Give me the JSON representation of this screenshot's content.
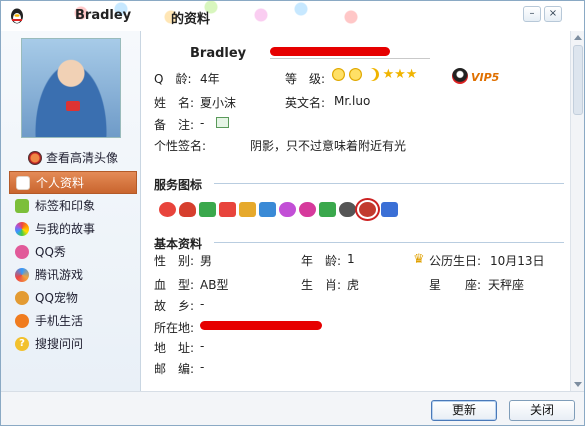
{
  "window": {
    "user_name": "Bradley",
    "title_suffix": "的资料",
    "minimize_glyph": "–",
    "close_glyph": "×"
  },
  "sidebar": {
    "hd_avatar_link": "查看高清头像",
    "items": [
      {
        "label": "个人资料",
        "active": true,
        "icon": "profile-card-icon",
        "color": "#ffffff"
      },
      {
        "label": "标签和印象",
        "active": false,
        "icon": "tag-icon",
        "color": "#7cbf3a"
      },
      {
        "label": "与我的故事",
        "active": false,
        "icon": "rainbow-icon",
        "color": "#c46bd6"
      },
      {
        "label": "QQ秀",
        "active": false,
        "icon": "qq-show-icon",
        "color": "#e15a9a"
      },
      {
        "label": "腾讯游戏",
        "active": false,
        "icon": "game-icon",
        "color": "#f2a23b"
      },
      {
        "label": "QQ宠物",
        "active": false,
        "icon": "pet-icon",
        "color": "#e39b33"
      },
      {
        "label": "手机生活",
        "active": false,
        "icon": "mobile-check-icon",
        "color": "#f07c1f"
      },
      {
        "label": "搜搜问问",
        "active": false,
        "icon": "question-icon",
        "color": "#f2c12e"
      }
    ]
  },
  "profile": {
    "nickname": "Bradley",
    "q_age_label": "Q　龄:",
    "q_age_value": "4年",
    "level_label": "等　级:",
    "vip_label": "VIP5",
    "name_label": "姓　名:",
    "name_value": "夏小沫",
    "english_name_label": "英文名:",
    "english_name_value": "Mr.luo",
    "note_label": "备　注:",
    "note_value": "-",
    "signature_label": "个性签名:",
    "signature_value": "阴影，只不过意味着附近有光"
  },
  "services": {
    "title": "服务图标",
    "icon_colors": [
      "#e8443c",
      "#d63f2e",
      "#3aa84c",
      "#e8443c",
      "#e6a92c",
      "#3a8ad6",
      "#c24fd6",
      "#d63a9c",
      "#3aa84c",
      "#555555",
      "#c23a2e",
      "#3a6fd6"
    ]
  },
  "basic": {
    "title": "基本资料",
    "gender_label": "性　别:",
    "gender_value": "男",
    "age_label": "年　龄:",
    "age_value": "1",
    "birthday_label": "公历生日:",
    "birthday_value": "10月13日",
    "blood_label": "血　型:",
    "blood_value": "AB型",
    "zodiac_label": "生　肖:",
    "zodiac_value": "虎",
    "star_label": "星　　座:",
    "star_value": "天秤座",
    "hometown_label": "故　乡:",
    "hometown_value": "-",
    "location_label": "所在地:",
    "address_label": "地　址:",
    "address_value": "-",
    "postcode_label": "邮　编:",
    "postcode_value": "-"
  },
  "footer": {
    "refresh_label": "更新",
    "close_label": "关闭"
  }
}
